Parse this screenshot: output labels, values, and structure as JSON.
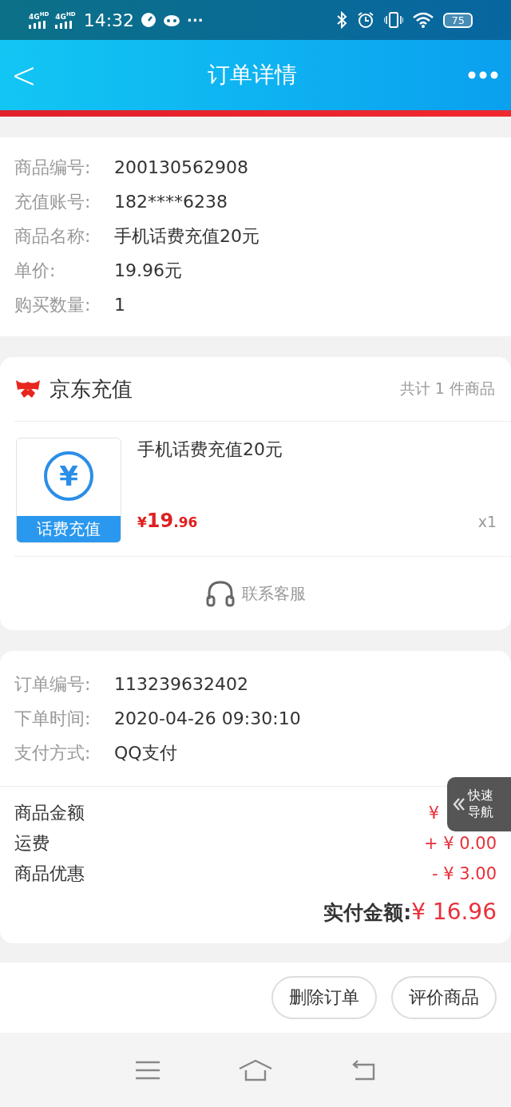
{
  "status_bar": {
    "signal_1": "4G",
    "signal_1_sup": "HD",
    "signal_2": "4G",
    "signal_2_sup": "HD",
    "time": "14:32",
    "more": "···",
    "battery": "75"
  },
  "header": {
    "back": "<",
    "title": "订单详情"
  },
  "product_info": [
    {
      "label": "商品编号:",
      "value": "200130562908"
    },
    {
      "label": "充值账号:",
      "value": "182****6238"
    },
    {
      "label": "商品名称:",
      "value": "手机话费充值20元"
    },
    {
      "label": "单价:",
      "value": "19.96元"
    },
    {
      "label": "购买数量:",
      "value": "1"
    }
  ],
  "shop": {
    "name": "京东充值",
    "count": "共计 1 件商品",
    "item": {
      "thumb_label": "话费充值",
      "thumb_symbol": "¥",
      "name": "手机话费充值20元",
      "price_currency": "¥",
      "price_int": "19",
      "price_dec": ".96",
      "quantity": "x1"
    },
    "service": "联系客服"
  },
  "order_info": [
    {
      "label": "订单编号:",
      "value": "113239632402"
    },
    {
      "label": "下单时间:",
      "value": "2020-04-26 09:30:10"
    },
    {
      "label": "支付方式:",
      "value": "QQ支付"
    }
  ],
  "amounts": [
    {
      "label": "商品金额",
      "value": "¥"
    },
    {
      "label": "运费",
      "value": "+ ¥ 0.00"
    },
    {
      "label": "商品优惠",
      "value": "- ¥ 3.00"
    }
  ],
  "total": {
    "label": "实付金额:",
    "value": "¥ 16.96"
  },
  "quick_nav": {
    "label_1": "快速",
    "label_2": "导航"
  },
  "actions": [
    "删除订单",
    "评价商品"
  ]
}
